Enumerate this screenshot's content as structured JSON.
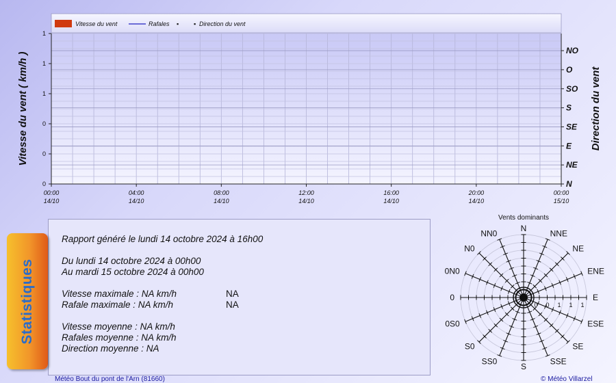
{
  "chart_data": [
    {
      "type": "line",
      "legend": {
        "position": "top-left",
        "entries": [
          "Vitesse du vent",
          "Rafales",
          "Direction du vent"
        ],
        "marker": "▪",
        "colors": [
          "#d03a10",
          "#2020c0",
          "#000000"
        ]
      },
      "ylabel_left": "Vitesse du vent ( km/h )",
      "ylabel_right": "Direction du vent",
      "y_left_ticks": [
        "0",
        "0",
        "0",
        "1",
        "1",
        "1"
      ],
      "y_right_ticks": [
        "N",
        "NE",
        "E",
        "SE",
        "S",
        "SO",
        "O",
        "NO"
      ],
      "x_ticks": [
        {
          "time": "00:00",
          "date": "14/10"
        },
        {
          "time": "04:00",
          "date": "14/10"
        },
        {
          "time": "08:00",
          "date": "14/10"
        },
        {
          "time": "12:00",
          "date": "14/10"
        },
        {
          "time": "16:00",
          "date": "14/10"
        },
        {
          "time": "20:00",
          "date": "14/10"
        },
        {
          "time": "00:00",
          "date": "15/10"
        }
      ],
      "series": [
        {
          "name": "Vitesse du vent",
          "values": []
        },
        {
          "name": "Rafales",
          "values": []
        },
        {
          "name": "Direction du vent",
          "values": []
        }
      ],
      "grid": true
    },
    {
      "type": "radar",
      "title": "Vents dominants",
      "directions": [
        "N",
        "NNE",
        "NE",
        "ENE",
        "E",
        "ESE",
        "SE",
        "SSE",
        "S",
        "SS0",
        "S0",
        "0S0",
        "0",
        "0N0",
        "N0",
        "NN0"
      ],
      "radial_labels": [
        "0",
        "0",
        "1",
        "1",
        "1"
      ],
      "values": []
    }
  ],
  "stats": {
    "tab_label": "Statistiques",
    "report_line": "Rapport généré le lundi 14 octobre 2024 à 16h00",
    "period_from": "Du lundi 14 octobre 2024 à 00h00",
    "period_to": "Au mardi 15 octobre 2024 à 00h00",
    "max_speed": "Vitesse maximale : NA km/h",
    "max_speed_value": "NA",
    "max_gust": "Rafale maximale : NA km/h",
    "max_gust_value": "NA",
    "avg_speed": "Vitesse moyenne : NA km/h",
    "avg_gust": "Rafales moyenne : NA km/h",
    "avg_direction": "Direction moyenne : NA"
  },
  "footer": {
    "station": "Météo Bout du pont de l'Arn (81660)",
    "copyright": "© Météo Villarzel"
  }
}
